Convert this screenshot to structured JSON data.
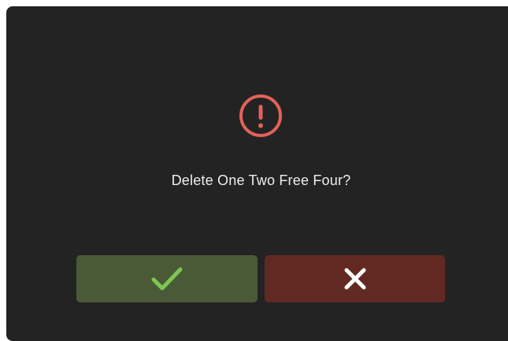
{
  "dialog": {
    "message": "Delete One Two Free Four?",
    "icon": "alert-circle-icon",
    "confirm_icon": "check-icon",
    "cancel_icon": "close-icon"
  },
  "colors": {
    "background": "#232323",
    "warning": "#e2625a",
    "confirm_bg": "#4a5a36",
    "confirm_icon": "#7cc653",
    "cancel_bg": "#622923",
    "cancel_icon": "#ffffff",
    "text": "#eeeeee"
  }
}
